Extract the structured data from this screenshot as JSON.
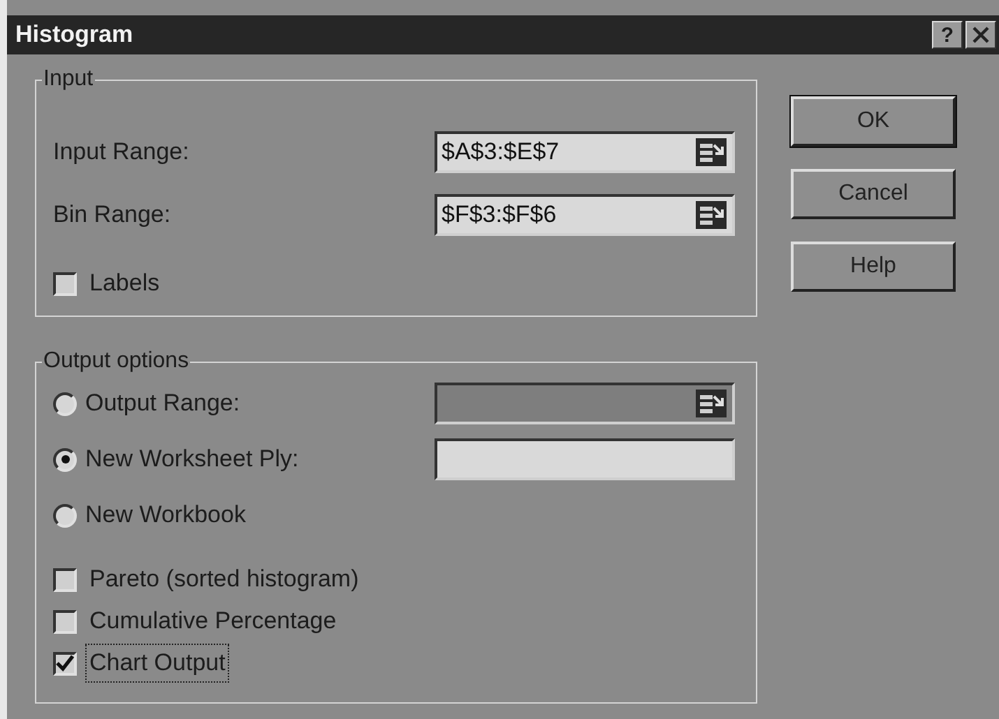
{
  "window": {
    "title": "Histogram",
    "help": "?"
  },
  "input_group": {
    "label": "Input",
    "fields": [
      {
        "label": "Input Range:",
        "value": "$A$3:$E$7"
      },
      {
        "label": "Bin Range:",
        "value": "$F$3:$F$6"
      }
    ],
    "labels_checkbox": {
      "label": "Labels",
      "checked": false
    }
  },
  "output_group": {
    "label": "Output options",
    "options": [
      {
        "label": "Output Range:",
        "selected": false,
        "field": {
          "disabled": true,
          "picker": true
        }
      },
      {
        "label": "New Worksheet Ply:",
        "selected": true,
        "field": {
          "disabled": false,
          "picker": false
        }
      },
      {
        "label": "New Workbook",
        "selected": false
      }
    ],
    "checkboxes": [
      {
        "label": "Pareto (sorted histogram)",
        "checked": false,
        "focused": false
      },
      {
        "label": "Cumulative Percentage",
        "checked": false,
        "focused": false
      },
      {
        "label": "Chart Output",
        "checked": true,
        "focused": true
      }
    ]
  },
  "buttons": [
    "OK",
    "Cancel",
    "Help"
  ]
}
